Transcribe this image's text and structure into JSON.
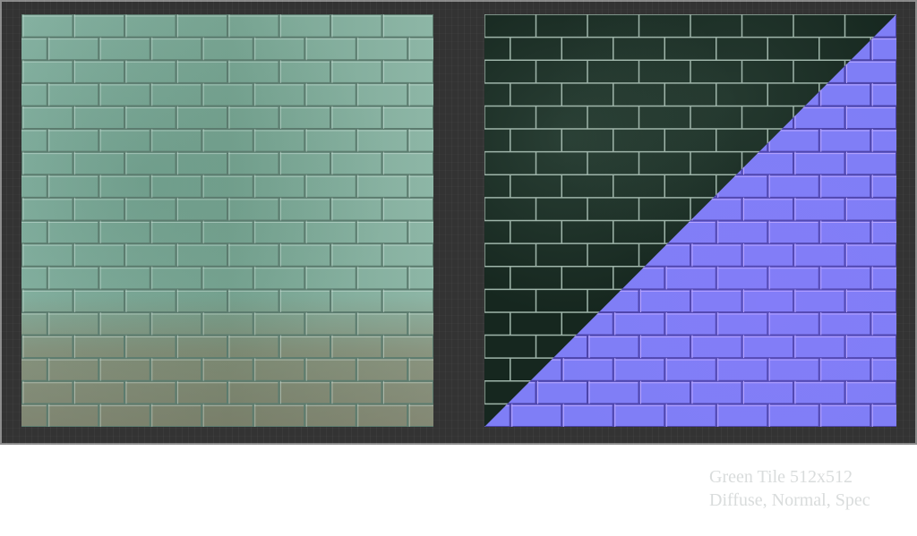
{
  "caption": {
    "line1": "Green Tile 512x512",
    "line2": "Diffuse, Normal, Spec"
  },
  "colors": {
    "frame": "#333333",
    "diffuse_tile": "#86b2a2",
    "diffuse_grout": "#5c7c6f",
    "spec_tile": "#16271f",
    "spec_grout": "#9fb5aa",
    "normal_tile": "#7f7ef6",
    "normal_grout_light": "#b9a7ff",
    "normal_grout_dark": "#4b43a8",
    "caption_text": "#d9dcdc"
  },
  "tiles": {
    "columns": 8,
    "rows": 18
  }
}
